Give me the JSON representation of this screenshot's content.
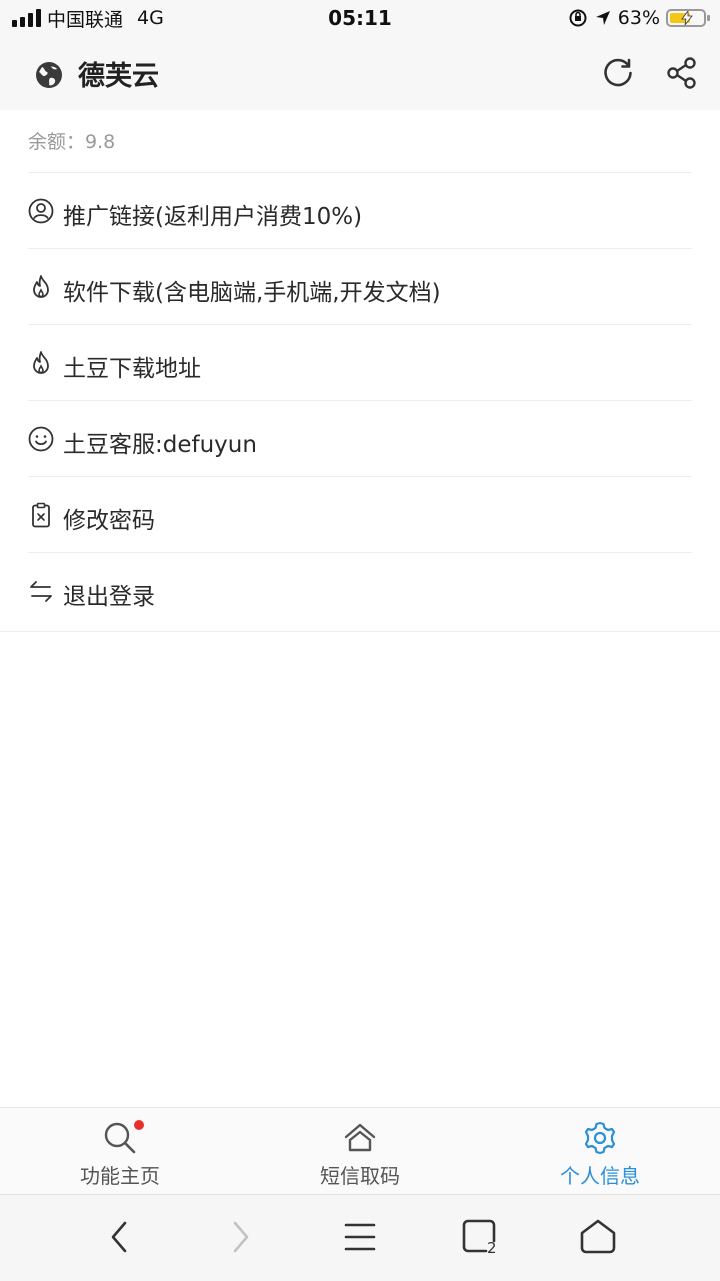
{
  "status_bar": {
    "carrier": "中国联通",
    "network": "4G",
    "time": "05:11",
    "battery": "63%",
    "battery_level": 0.63
  },
  "header": {
    "title": "德芙云",
    "globe_icon": "globe-icon",
    "refresh_icon": "refresh-icon",
    "share_icon": "share-icon"
  },
  "balance": {
    "text": "余额：9.8"
  },
  "menu": {
    "items": [
      {
        "label": "推广链接(返利用户消费10%)",
        "icon": "user-circle-icon"
      },
      {
        "label": "软件下载(含电脑端,手机端,开发文档)",
        "icon": "flame-icon"
      },
      {
        "label": "土豆下载地址",
        "icon": "flame-icon"
      },
      {
        "label": "土豆客服:defuyun",
        "icon": "smile-icon"
      },
      {
        "label": "修改密码",
        "icon": "clipboard-x-icon"
      },
      {
        "label": "退出登录",
        "icon": "swap-arrows-icon"
      }
    ]
  },
  "tabbar": {
    "tabs": [
      {
        "label": "功能主页",
        "icon": "search-icon",
        "active": false,
        "badge": true
      },
      {
        "label": "短信取码",
        "icon": "home-icon",
        "active": false,
        "badge": false
      },
      {
        "label": "个人信息",
        "icon": "gear-icon",
        "active": true,
        "badge": false
      }
    ]
  },
  "browser_bar": {
    "tab_count": "2"
  },
  "colors": {
    "accent": "#2a8fd8",
    "badge": "#e5322d",
    "battery_fill": "#f5c518"
  }
}
